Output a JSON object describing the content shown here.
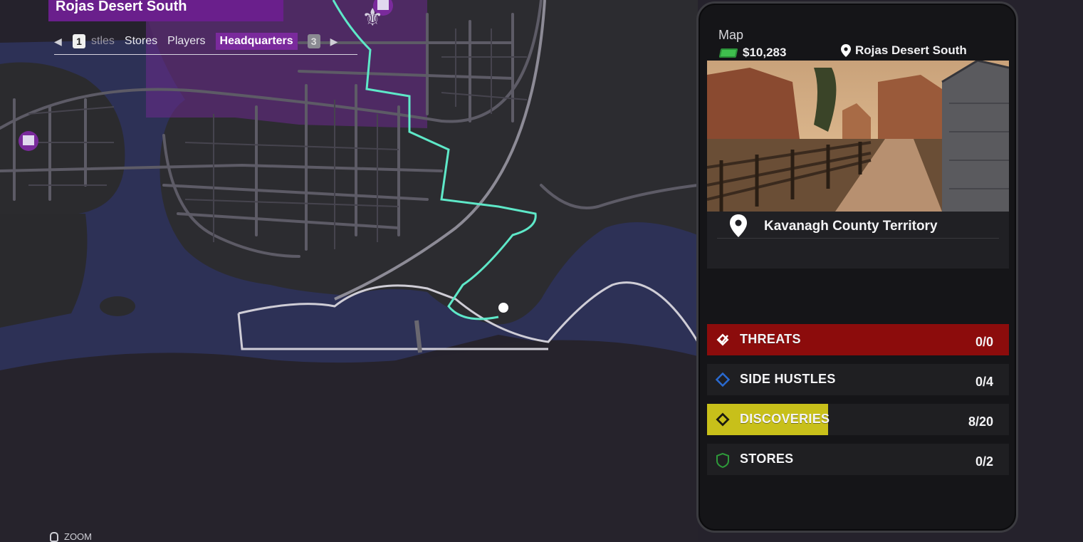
{
  "header": {
    "region_title": "Rojas Desert South",
    "tabs": {
      "left_key": "1",
      "partial_tab": "stles",
      "items": [
        "Stores",
        "Players",
        "Headquarters"
      ],
      "active": "Headquarters",
      "right_key": "3"
    }
  },
  "footer": {
    "zoom_label": "ZOOM"
  },
  "panel": {
    "title": "Map",
    "money": "$10,283",
    "location": "Rojas Desert South",
    "territory": "Kavanagh County Territory",
    "stats": [
      {
        "label": "THREATS",
        "count": "0/0",
        "color": "#8c0c0c",
        "icon": "threat-check-icon",
        "progress": 1.0
      },
      {
        "label": "SIDE HUSTLES",
        "count": "0/4",
        "color": "#2a6ad0",
        "icon": "side-hustle-diamond-icon",
        "progress": 0.0
      },
      {
        "label": "DISCOVERIES",
        "count": "8/20",
        "color": "#c8c01a",
        "icon": "discovery-diamond-icon",
        "progress": 0.4
      },
      {
        "label": "STORES",
        "count": "0/2",
        "color": "#2e9a3a",
        "icon": "store-shield-icon",
        "progress": 0.0
      }
    ]
  },
  "colors": {
    "accent_purple": "#6a1f8c",
    "route": "#5ee8c8",
    "water": "#2e3257",
    "land": "#2a2a2e"
  }
}
